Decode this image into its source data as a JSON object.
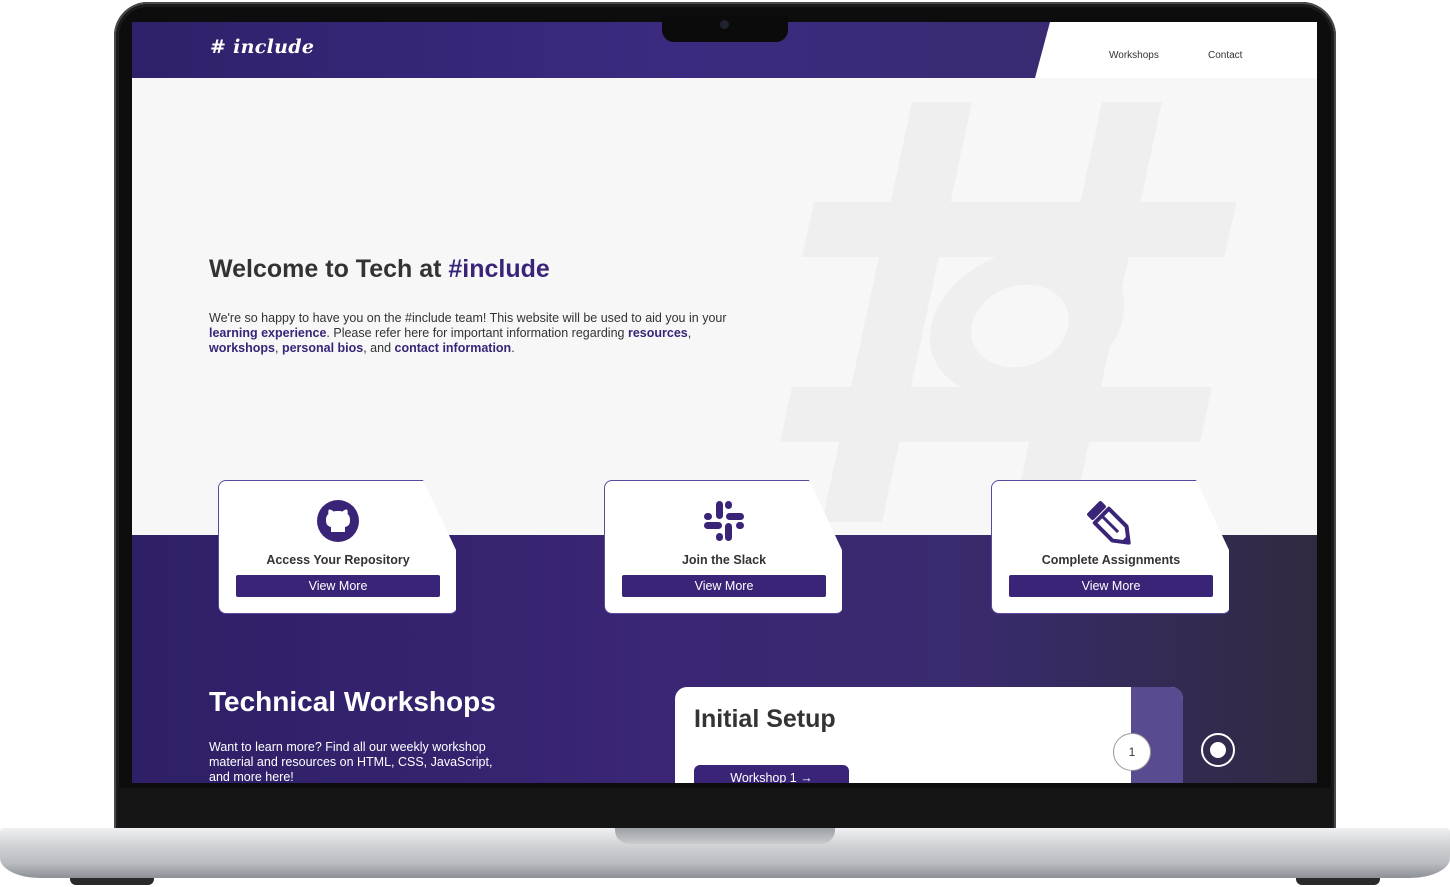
{
  "nav": {
    "logo": "# include",
    "links": [
      "Workshops",
      "Contact"
    ]
  },
  "hero": {
    "title_prefix": "Welcome to Tech at ",
    "title_accent": "#include",
    "text": {
      "t1": "We're so happy to have you on the #include team! This website will be used to aid you in your ",
      "l1": "learning experience",
      "t2": ". Please refer here for important information regarding ",
      "l2": "resources",
      "t3": ", ",
      "l3": "workshops",
      "t4": ", ",
      "l4": "personal bios",
      "t5": ", and ",
      "l5": "contact information",
      "t6": "."
    }
  },
  "cards": [
    {
      "title": "Access Your Repository",
      "button": "View More",
      "icon": "github-icon"
    },
    {
      "title": "Join the Slack",
      "button": "View More",
      "icon": "slack-icon"
    },
    {
      "title": "Complete Assignments",
      "button": "View More",
      "icon": "pencil-icon"
    }
  ],
  "workshops": {
    "title": "Technical Workshops",
    "text": "Want to learn more? Find all our weekly workshop material and resources on HTML, CSS, JavaScript, and more here!",
    "card": {
      "title": "Initial Setup",
      "button": "Workshop 1 →",
      "number": "1"
    }
  },
  "colors": {
    "brand_purple": "#3a2478",
    "band_purple": "#2f1f66",
    "background": "#f7f7f8"
  }
}
